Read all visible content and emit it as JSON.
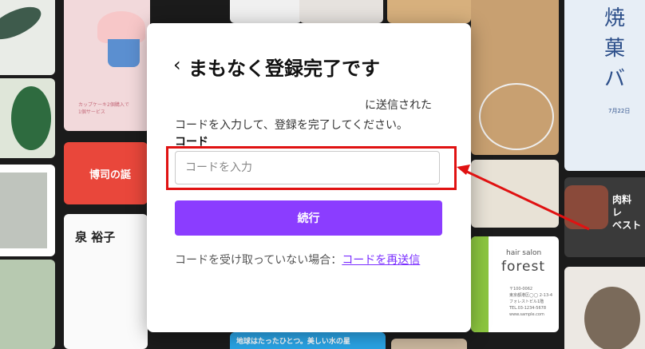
{
  "modal": {
    "back_icon": "chevron-left-icon",
    "back_glyph": "‹",
    "title": "まもなく登録完了です",
    "desc_line1": "に送信された",
    "desc_line2": "コードを入力して、登録を完了してください。",
    "code_label": "コード",
    "code_input": {
      "value": "",
      "placeholder": "コードを入力"
    },
    "continue_button": "続行",
    "resend_prefix": "コードを受け取っていない場合：",
    "resend_link": "コードを再送信"
  },
  "background_tiles": {
    "cupcake_text": "カップケーキ2個購入で\n1個サービス",
    "event_title": "博司の誕",
    "resume_name": "泉 裕子",
    "salon_label": "hair salon",
    "salon_name": "forest",
    "sweets_title": "焼\n菓\nバ",
    "meat_text": "肉料\nレ\nベスト",
    "earth_text": "地球はたったひとつ。美しい水の星",
    "guide_date": "7月22日",
    "salon_info": "〒100-0062\n東京都港区◯◯ 2-13-4\nフォレストビル1階\nTEL.03-1234-5678\nwww.sample.com"
  },
  "annotation": {
    "highlight_color": "#e01212"
  },
  "colors": {
    "accent": "#8b3dff",
    "link": "#7b2fff"
  }
}
